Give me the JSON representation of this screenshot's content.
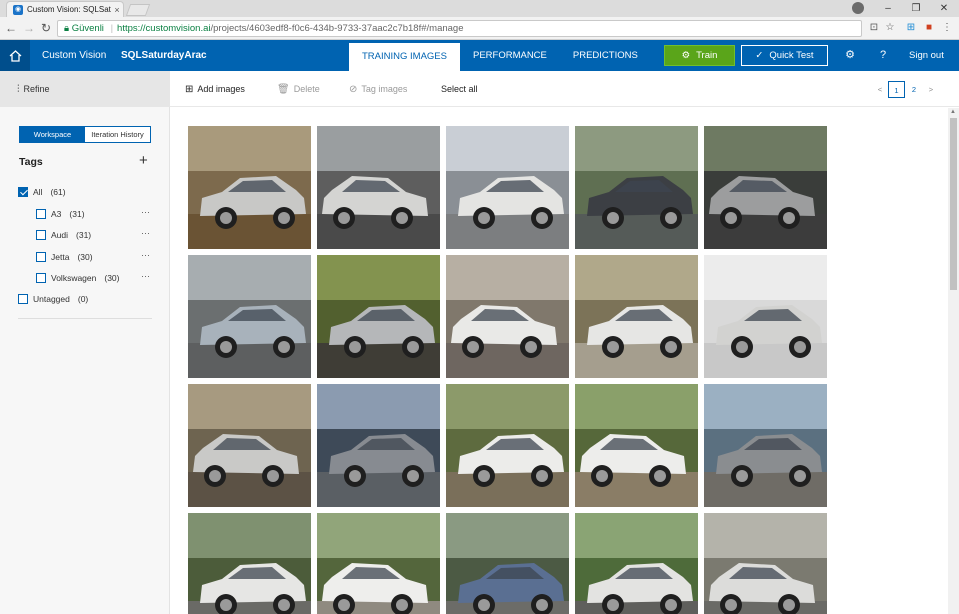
{
  "browser": {
    "tab_title": "Custom Vision: SQLSatur",
    "tab_close": "×",
    "secure_label": "Güvenli",
    "url_host": "https://customvision.ai",
    "url_path": "/projects/4603edf8-f0c6-434b-9733-37aac2c7b18f#/manage"
  },
  "header": {
    "app_name": "Custom Vision",
    "project_name": "SQLSaturdayArac",
    "tabs": [
      {
        "label": "TRAINING IMAGES",
        "active": true
      },
      {
        "label": "PERFORMANCE",
        "active": false
      },
      {
        "label": "PREDICTIONS",
        "active": false
      }
    ],
    "train_label": "Train",
    "quick_test_label": "Quick Test",
    "help_label": "?",
    "sign_out_label": "Sign out",
    "accent_color": "#0063b1",
    "train_color": "#5aa51a"
  },
  "sidebar": {
    "refine_label": "Refine",
    "segments": [
      {
        "label": "Workspace",
        "active": true
      },
      {
        "label": "Iteration History",
        "active": false
      }
    ],
    "tags_heading": "Tags",
    "all": {
      "label": "All",
      "count": "(61)",
      "checked": true
    },
    "tags": [
      {
        "label": "A3",
        "count": "(31)"
      },
      {
        "label": "Audi",
        "count": "(31)"
      },
      {
        "label": "Jetta",
        "count": "(30)"
      },
      {
        "label": "Volkswagen",
        "count": "(30)"
      }
    ],
    "untagged": {
      "label": "Untagged",
      "count": "(0)"
    },
    "more_label": "···"
  },
  "toolbar": {
    "add_images": "Add images",
    "delete": "Delete",
    "tag_images": "Tag images",
    "select_all": "Select all",
    "pager": {
      "prev": "<",
      "pages": [
        "1",
        "2"
      ],
      "current": "1",
      "next": ">"
    }
  },
  "images": [
    {
      "bg": "#7d6a4d",
      "sky": "#a99a7c",
      "car": "#c8c8c6",
      "ground": "#6a5334"
    },
    {
      "bg": "#5e5e5e",
      "sky": "#9a9ea0",
      "car": "#d4d4d2",
      "ground": "#4a4a4a"
    },
    {
      "bg": "#8a8f95",
      "sky": "#c9ced5",
      "car": "#e4e4e2",
      "ground": "#7c7e80"
    },
    {
      "bg": "#5f6f52",
      "sky": "#8d9a80",
      "car": "#3c3f44",
      "ground": "#555b58"
    },
    {
      "bg": "#3a3d3a",
      "sky": "#6e7a62",
      "car": "#9c9d9e",
      "ground": "#3c3c3c"
    },
    {
      "bg": "#6b6f70",
      "sky": "#a7adb0",
      "car": "#a8b2bb",
      "ground": "#5d5f60"
    },
    {
      "bg": "#52602f",
      "sky": "#83934f",
      "car": "#b5b7b9",
      "ground": "#3f3d36"
    },
    {
      "bg": "#80786c",
      "sky": "#b7afa3",
      "car": "#e9e9e7",
      "ground": "#6e6660"
    },
    {
      "bg": "#7c7358",
      "sky": "#b0a88a",
      "car": "#e6e6e4",
      "ground": "#a59e8e"
    },
    {
      "bg": "#d9d9d9",
      "sky": "#ececec",
      "car": "#d2d2d0",
      "ground": "#c8c8c8"
    },
    {
      "bg": "#6e6450",
      "sky": "#a79a80",
      "car": "#c9c9c7",
      "ground": "#5c5245"
    },
    {
      "bg": "#3e4a58",
      "sky": "#8b9bb0",
      "car": "#878b91",
      "ground": "#5a5f64"
    },
    {
      "bg": "#5e6b3f",
      "sky": "#8c9a6a",
      "car": "#ececea",
      "ground": "#7a6f5a"
    },
    {
      "bg": "#56683a",
      "sky": "#8aa06a",
      "car": "#ededeb",
      "ground": "#8a7d66"
    },
    {
      "bg": "#5b7080",
      "sky": "#9bb0c2",
      "car": "#8a8d90",
      "ground": "#6f6c66"
    },
    {
      "bg": "#4c5c3a",
      "sky": "#7f9170",
      "car": "#e6e6e4",
      "ground": "#6a6a66"
    },
    {
      "bg": "#54663c",
      "sky": "#91a57a",
      "car": "#eeeeec",
      "ground": "#8f8a80"
    },
    {
      "bg": "#4c5a44",
      "sky": "#8a9a82",
      "car": "#5a6f92",
      "ground": "#6c6c68"
    },
    {
      "bg": "#4e6b3a",
      "sky": "#8aa474",
      "car": "#e3e3e1",
      "ground": "#5f5f5c"
    },
    {
      "bg": "#7b7a70",
      "sky": "#b4b3aa",
      "car": "#dcdcda",
      "ground": "#6a6a66"
    }
  ]
}
